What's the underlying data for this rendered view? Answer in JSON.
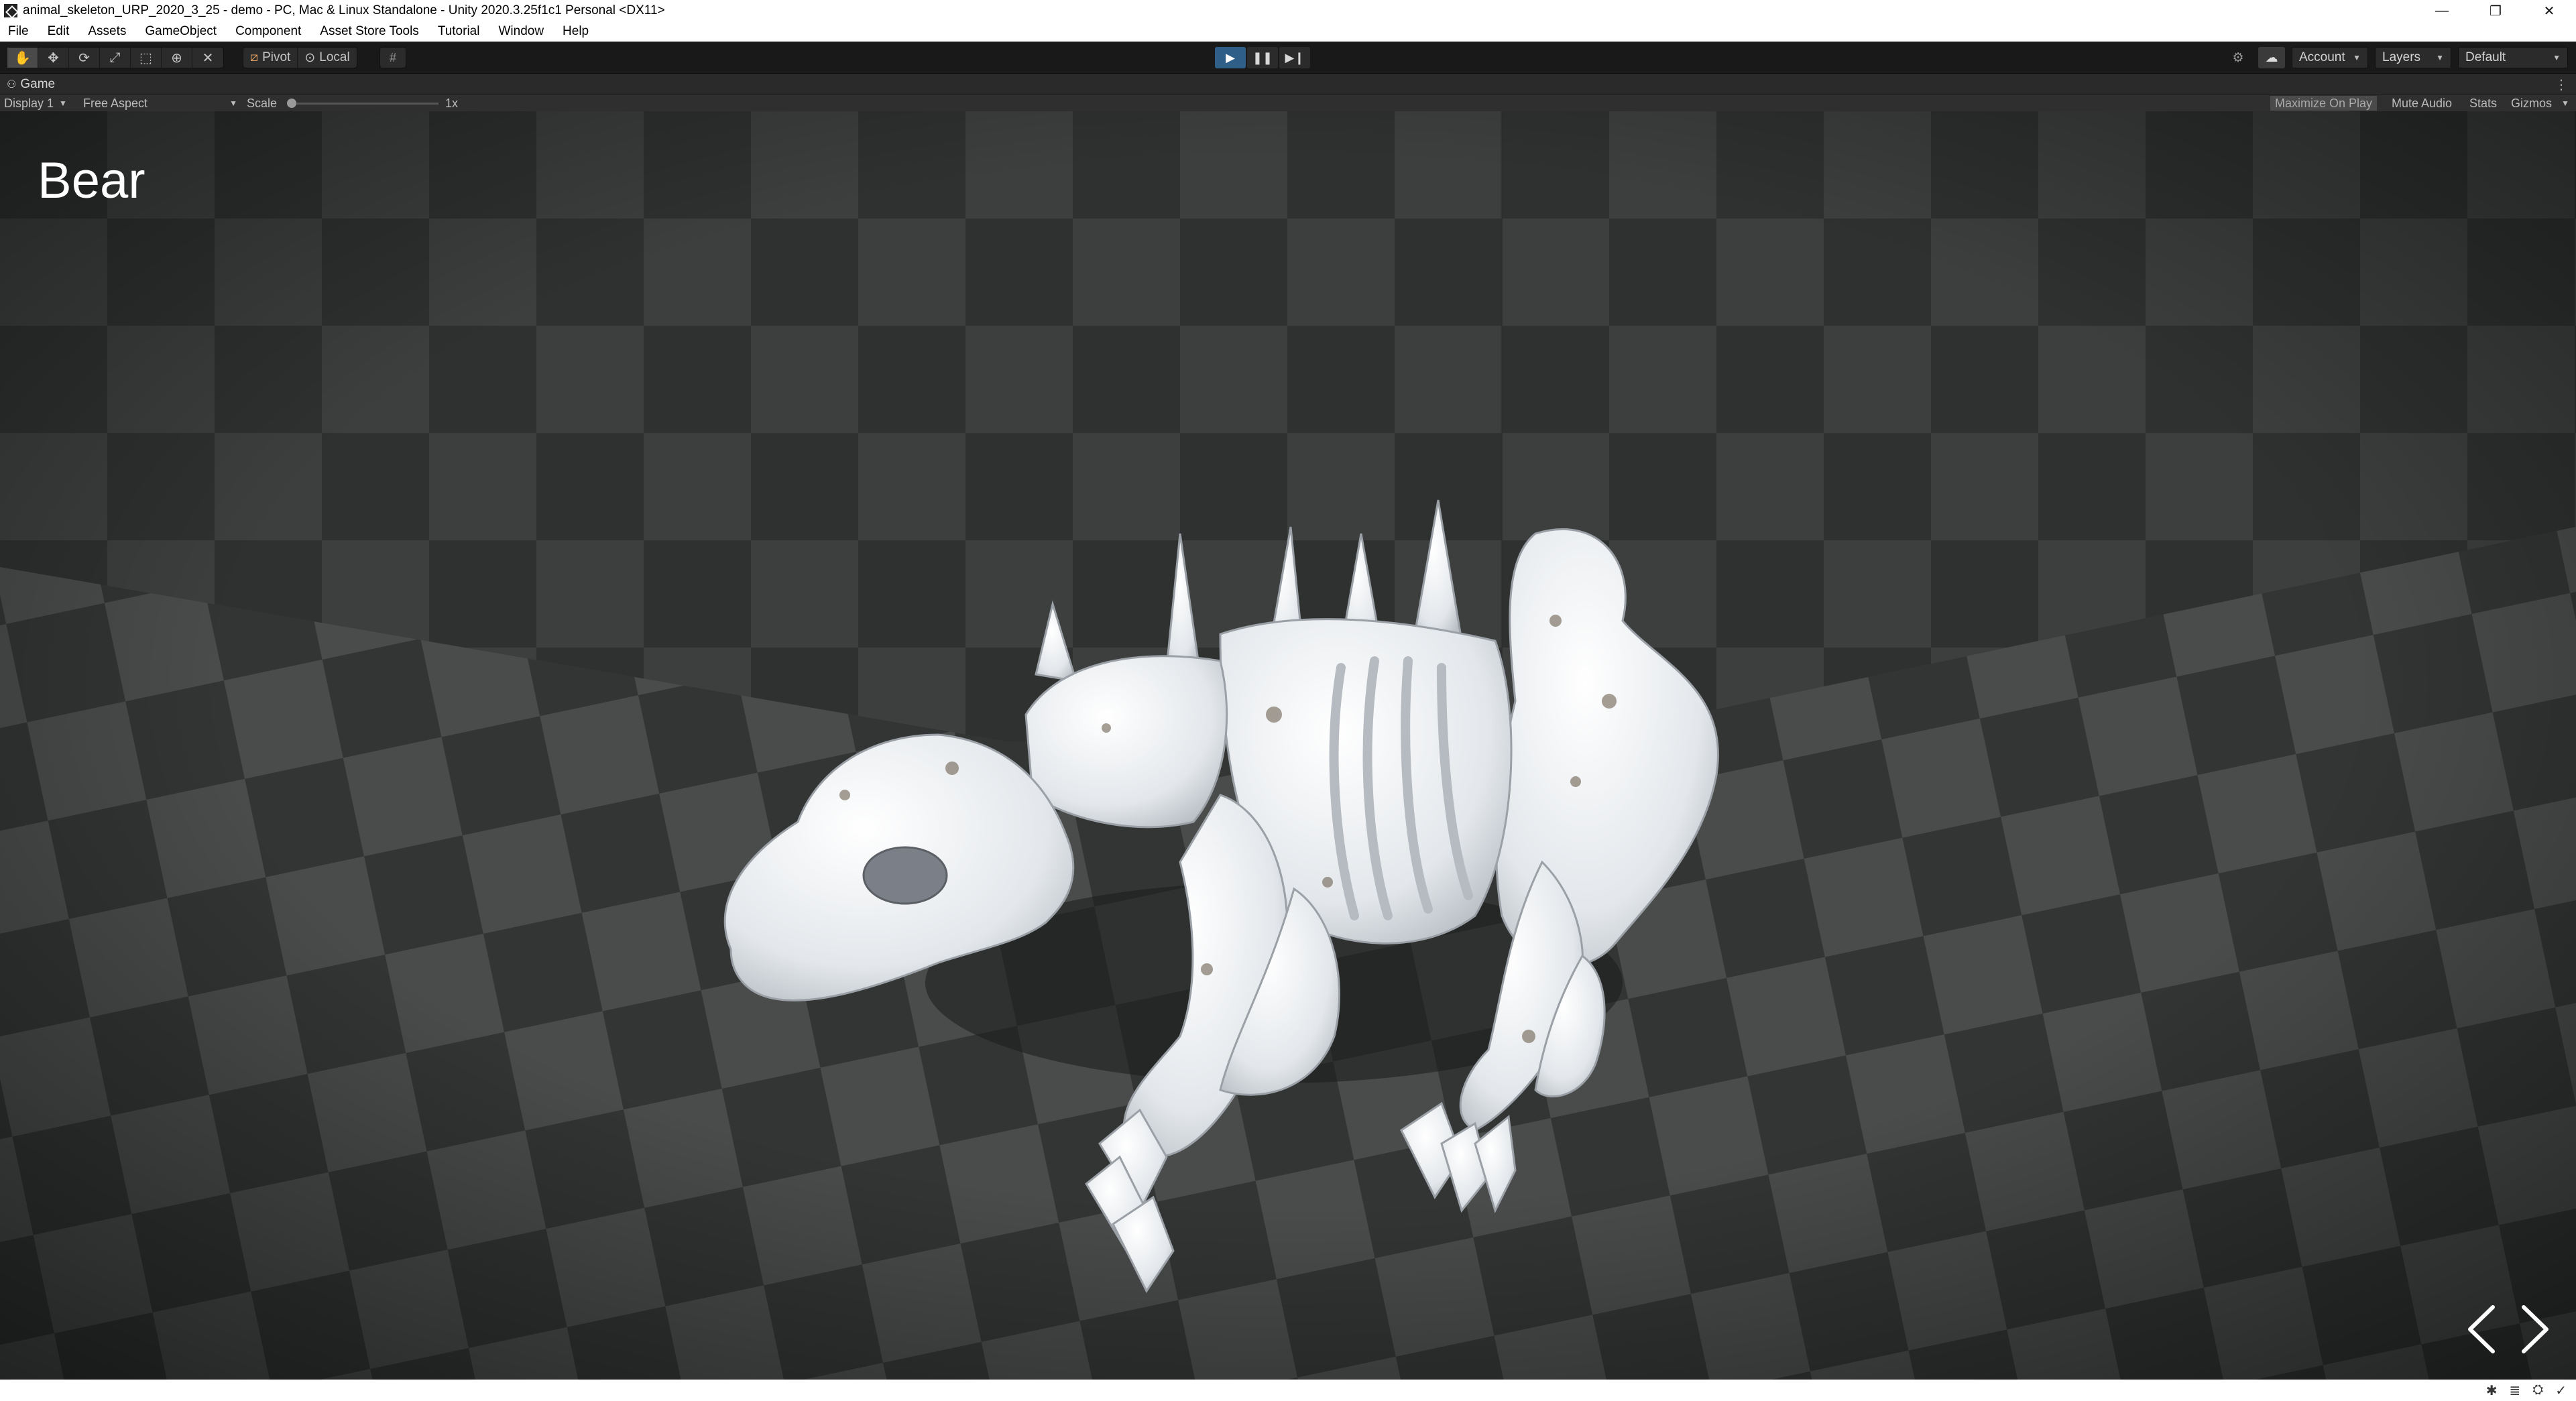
{
  "window": {
    "title": "animal_skeleton_URP_2020_3_25 - demo - PC, Mac & Linux Standalone - Unity 2020.3.25f1c1 Personal <DX11>",
    "controls": [
      "—",
      "❐",
      "✕"
    ]
  },
  "menu": {
    "items": [
      "File",
      "Edit",
      "Assets",
      "GameObject",
      "Component",
      "Asset Store Tools",
      "Tutorial",
      "Window",
      "Help"
    ]
  },
  "toolbar": {
    "tools": [
      "hand-tool-icon",
      "move-tool-icon",
      "rotate-tool-icon",
      "scale-tool-icon",
      "rect-tool-icon",
      "transform-tool-icon",
      "custom-tool-icon"
    ],
    "pivot_label": "Pivot",
    "local_label": "Local",
    "account_label": "Account",
    "layers_label": "Layers",
    "layout_label": "Default",
    "play_state": "playing"
  },
  "game_tab": {
    "label": "Game"
  },
  "game_bar": {
    "display": "Display 1",
    "aspect": "Free Aspect",
    "scale_label": "Scale",
    "scale_value": "1x",
    "maximize_on_play": "Maximize On Play",
    "mute_audio": "Mute Audio",
    "stats": "Stats",
    "gizmos": "Gizmos"
  },
  "viewport": {
    "model_name": "Bear",
    "prev_icon": "chevron-left-icon",
    "next_icon": "chevron-right-icon"
  },
  "colors": {
    "play_active": "#2f5e88",
    "floor_dark": "#353737",
    "floor_light": "#4b4d4d",
    "bone": "#e9ecef"
  }
}
